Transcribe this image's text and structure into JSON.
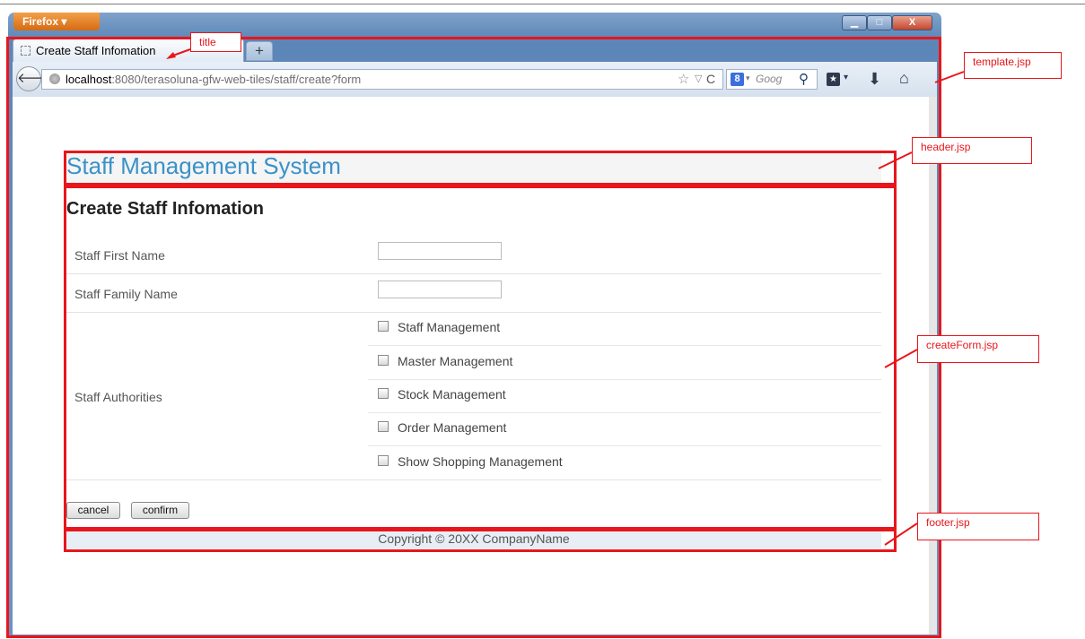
{
  "browser": {
    "app_button": "Firefox ▾",
    "window_controls": {
      "minimize": "▁",
      "maximize": "□",
      "close": "X"
    },
    "tab_title": "Create Staff Infomation",
    "new_tab": "+",
    "url_host": "localhost",
    "url_path": ":8080/terasoluna-gfw-web-tiles/staff/create?form",
    "search_engine_icon": "8",
    "search_placeholder": "Goog",
    "icons": {
      "back": "back-icon",
      "site": "globe-icon",
      "bookmark_star": "star-icon",
      "reload": "reload-icon",
      "search": "search-icon",
      "bookmarks": "bookmarks-icon",
      "download": "download-icon",
      "home": "home-icon"
    }
  },
  "page": {
    "app_title": "Staff Management System",
    "form_title": "Create Staff Infomation",
    "fields": [
      {
        "label": "Staff First Name",
        "value": ""
      },
      {
        "label": "Staff Family Name",
        "value": ""
      }
    ],
    "authorities_label": "Staff Authorities",
    "authorities": [
      {
        "label": "Staff Management",
        "checked": false
      },
      {
        "label": "Master Management",
        "checked": false
      },
      {
        "label": "Stock Management",
        "checked": false
      },
      {
        "label": "Order Management",
        "checked": false
      },
      {
        "label": "Show Shopping Management",
        "checked": false
      }
    ],
    "buttons": {
      "cancel": "cancel",
      "confirm": "confirm"
    },
    "footer": "Copyright © 20XX CompanyName"
  },
  "annotations": {
    "title": "title",
    "template": "template.jsp",
    "header": "header.jsp",
    "createForm": "createForm.jsp",
    "footer": "footer.jsp",
    "color": "#e8161b"
  }
}
